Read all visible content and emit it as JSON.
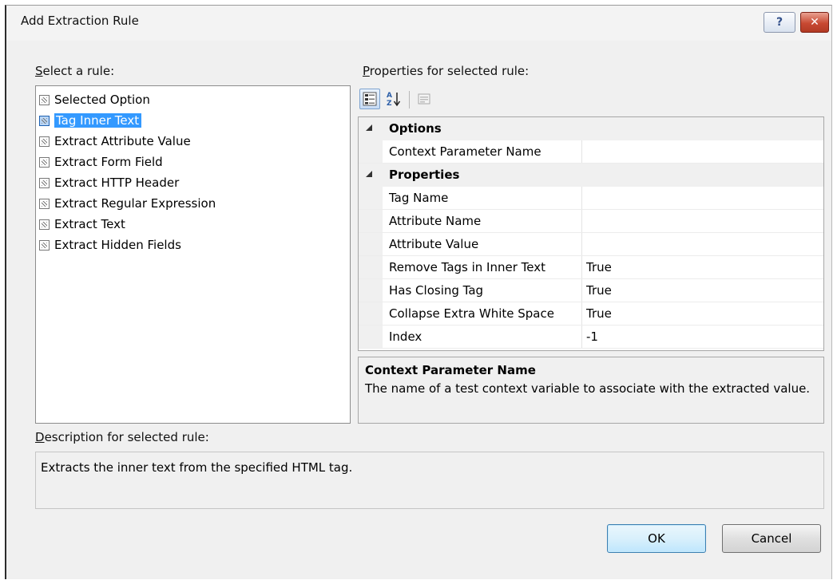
{
  "window": {
    "title": "Add Extraction Rule",
    "help_label": "?",
    "close_label": "✕"
  },
  "rules_label": {
    "key": "S",
    "rest": "elect a rule:"
  },
  "rules": [
    {
      "label": "Selected Option",
      "selected": false
    },
    {
      "label": "Tag Inner Text",
      "selected": true
    },
    {
      "label": "Extract Attribute Value",
      "selected": false
    },
    {
      "label": "Extract Form Field",
      "selected": false
    },
    {
      "label": "Extract HTTP Header",
      "selected": false
    },
    {
      "label": "Extract Regular Expression",
      "selected": false
    },
    {
      "label": "Extract Text",
      "selected": false
    },
    {
      "label": "Extract Hidden Fields",
      "selected": false
    }
  ],
  "properties_label": {
    "key": "P",
    "rest": "roperties for selected rule:"
  },
  "toolbar": {
    "categorized_icon": "categorized-icon",
    "alphabetical_icon": "sort-az-icon",
    "property_pages_icon": "property-pages-icon"
  },
  "property_grid": {
    "categories": [
      {
        "name": "Options",
        "properties": [
          {
            "name": "Context Parameter Name",
            "value": ""
          }
        ]
      },
      {
        "name": "Properties",
        "properties": [
          {
            "name": "Tag Name",
            "value": ""
          },
          {
            "name": "Attribute Name",
            "value": ""
          },
          {
            "name": "Attribute Value",
            "value": ""
          },
          {
            "name": "Remove Tags in Inner Text",
            "value": "True"
          },
          {
            "name": "Has Closing Tag",
            "value": "True"
          },
          {
            "name": "Collapse Extra White Space",
            "value": "True"
          },
          {
            "name": "Index",
            "value": "-1"
          }
        ]
      }
    ]
  },
  "help_pane": {
    "title": "Context Parameter Name",
    "text": "The name of a test context variable to associate with the extracted value."
  },
  "description_label": {
    "key": "D",
    "rest": "escription for selected rule:"
  },
  "description": "Extracts the inner text from the specified HTML tag.",
  "buttons": {
    "ok": "OK",
    "cancel": "Cancel"
  },
  "colors": {
    "selection": "#3399ff",
    "dialog_bg": "#f0f0f0"
  }
}
